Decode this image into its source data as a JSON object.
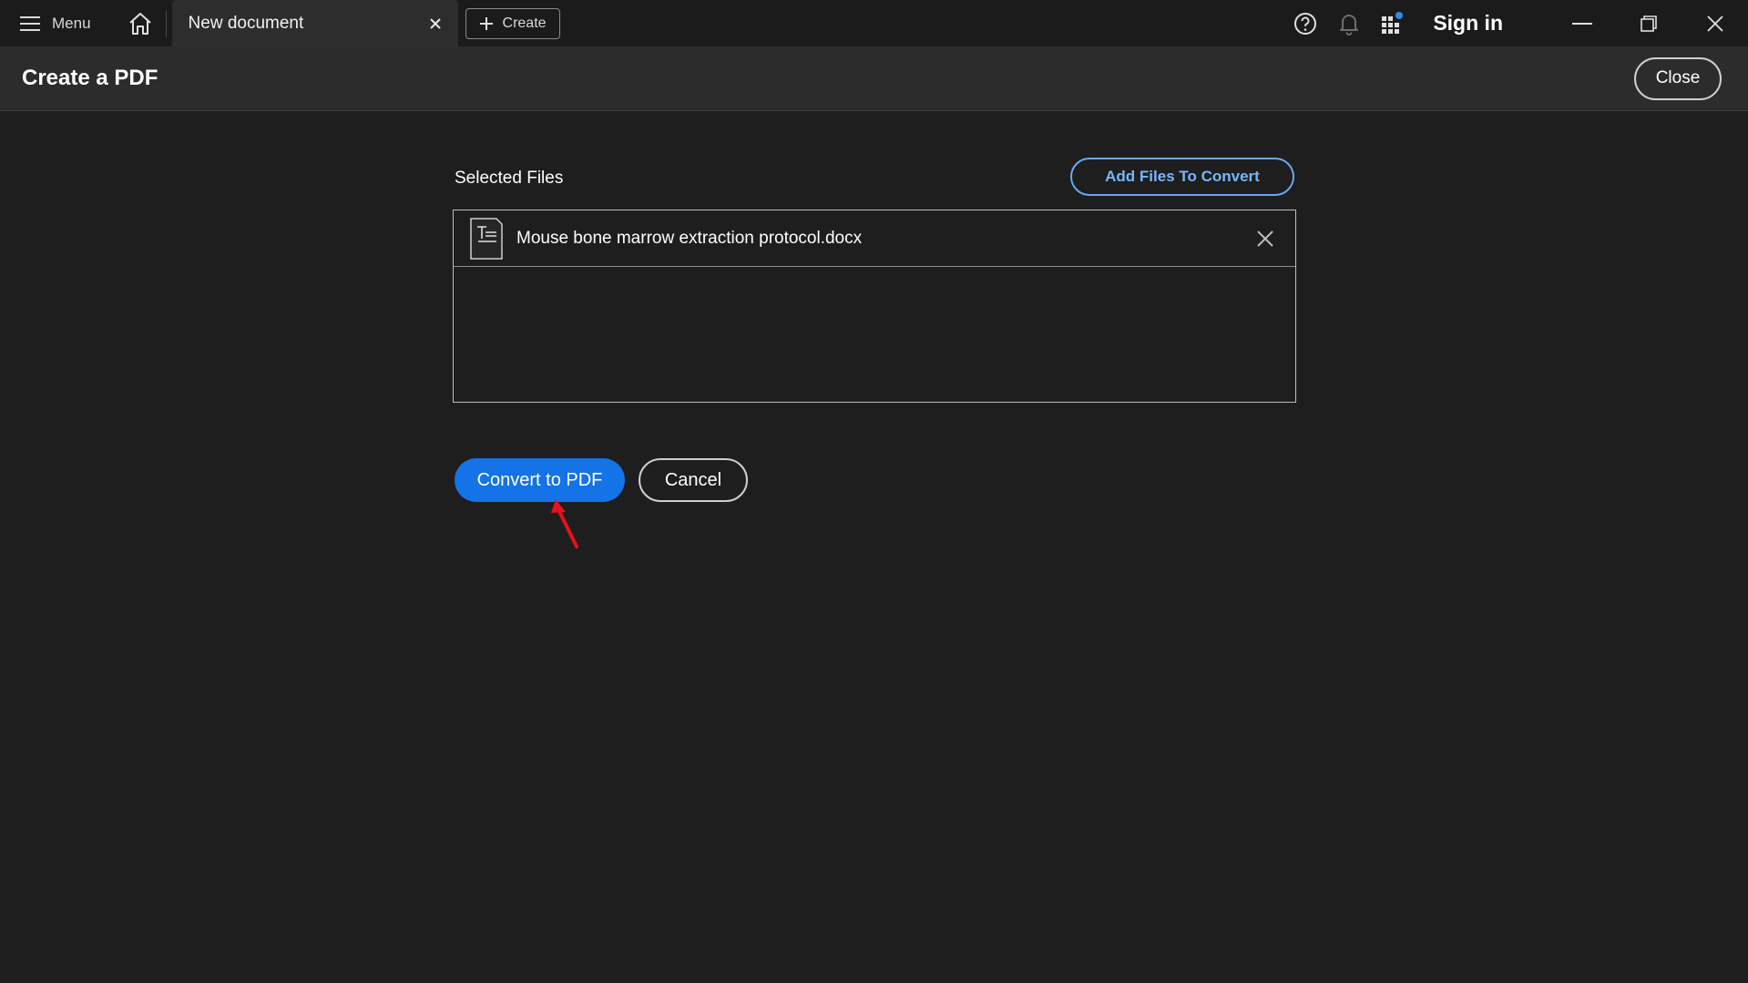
{
  "titlebar": {
    "menu_label": "Menu",
    "tab_label": "New document",
    "create_label": "Create",
    "signin_label": "Sign in",
    "icons": {
      "menu": "hamburger-icon",
      "home": "home-icon",
      "tab_close": "close-icon",
      "create": "plus-icon",
      "help": "help-icon",
      "notifications": "bell-icon",
      "apps": "apps-grid-icon",
      "minimize": "minimize-icon",
      "restore": "restore-icon",
      "window_close": "close-icon"
    },
    "colors": {
      "apps_badge": "#2d8ceb"
    }
  },
  "header": {
    "title": "Create a PDF",
    "close_label": "Close"
  },
  "main": {
    "selected_files_label": "Selected Files",
    "add_files_label": "Add Files To Convert",
    "files": [
      {
        "name": "Mouse bone marrow extraction protocol.docx",
        "icon": "document-text-icon"
      }
    ],
    "convert_label": "Convert to PDF",
    "cancel_label": "Cancel"
  },
  "colors": {
    "accent": "#1473e6",
    "link": "#76b6ff",
    "background": "#1e1e1e",
    "annotation_arrow": "#e8101a"
  }
}
